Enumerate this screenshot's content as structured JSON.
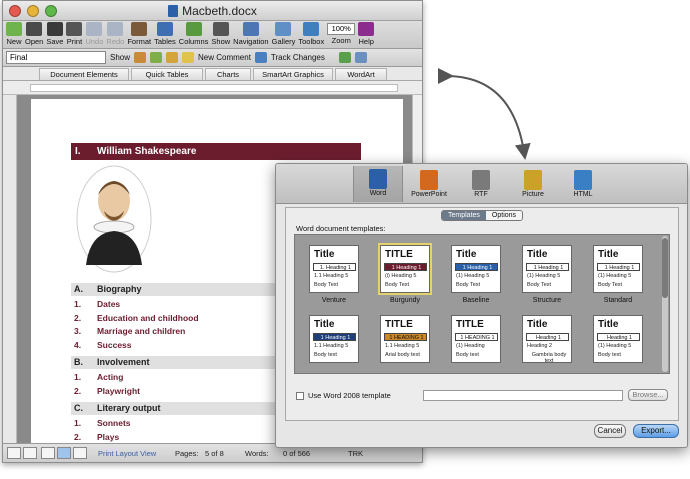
{
  "window": {
    "title": "Macbeth.docx"
  },
  "toolbar": {
    "buttons": [
      {
        "label": "New",
        "icon": "new-document-icon",
        "color": "#6fb34f"
      },
      {
        "label": "Open",
        "icon": "open-folder-icon",
        "color": "#4a4a4a"
      },
      {
        "label": "Save",
        "icon": "save-disk-icon",
        "color": "#3a3a3a"
      },
      {
        "label": "Print",
        "icon": "printer-icon",
        "color": "#555555"
      },
      {
        "label": "Undo",
        "icon": "undo-icon",
        "color": "#aab4c4"
      },
      {
        "label": "Redo",
        "icon": "redo-icon",
        "color": "#aab4c4"
      },
      {
        "label": "Format",
        "icon": "paintbrush-icon",
        "color": "#7a5a3a"
      },
      {
        "label": "Tables",
        "icon": "table-icon",
        "color": "#3f6fb0"
      },
      {
        "label": "Columns",
        "icon": "columns-icon",
        "color": "#5a9a3f"
      },
      {
        "label": "Show",
        "icon": "pilcrow-icon",
        "color": "#555555"
      },
      {
        "label": "Navigation",
        "icon": "navigation-pane-icon",
        "color": "#4d76b5"
      },
      {
        "label": "Gallery",
        "icon": "gallery-icon",
        "color": "#5f8fc7"
      },
      {
        "label": "Toolbox",
        "icon": "toolbox-icon",
        "color": "#3f7fc0"
      },
      {
        "label": "Zoom",
        "icon": "zoom-icon",
        "color": "#ffffff"
      },
      {
        "label": "Help",
        "icon": "help-icon",
        "color": "#8a2d8c"
      }
    ],
    "zoom_value": "100%"
  },
  "toolbar2": {
    "style_value": "Final",
    "show_label": "Show",
    "new_comment_label": "New Comment",
    "track_changes_label": "Track Changes"
  },
  "ribbon": {
    "tabs": [
      "Document Elements",
      "Quick Tables",
      "Charts",
      "SmartArt Graphics",
      "WordArt"
    ]
  },
  "document": {
    "chapter": {
      "number": "I.",
      "title": "William Shakespeare"
    },
    "sections": [
      {
        "letter": "A.",
        "title": "Biography",
        "items": [
          {
            "n": "1.",
            "t": "Dates"
          },
          {
            "n": "2.",
            "t": "Education and childhood"
          },
          {
            "n": "3.",
            "t": "Marriage and children"
          },
          {
            "n": "4.",
            "t": "Success"
          }
        ]
      },
      {
        "letter": "B.",
        "title": "Involvement",
        "items": [
          {
            "n": "1.",
            "t": "Acting"
          },
          {
            "n": "2.",
            "t": "Playwright"
          }
        ]
      },
      {
        "letter": "C.",
        "title": "Literary output",
        "items": [
          {
            "n": "1.",
            "t": "Sonnets"
          },
          {
            "n": "2.",
            "t": "Plays"
          }
        ]
      }
    ],
    "accent_color": "#6b1d2e"
  },
  "statusbar": {
    "view_name": "Print Layout View",
    "pages_label": "Pages:",
    "pages_value": "5 of 8",
    "words_label": "Words:",
    "words_value": "0 of 566",
    "trk_label": "TRK"
  },
  "dialog": {
    "formats": [
      {
        "label": "Word",
        "icon": "word-format-icon",
        "color": "#2b5fa8"
      },
      {
        "label": "PowerPoint",
        "icon": "powerpoint-format-icon",
        "color": "#d2691e"
      },
      {
        "label": "RTF",
        "icon": "rtf-format-icon",
        "color": "#7a7a7a"
      },
      {
        "label": "Picture",
        "icon": "picture-format-icon",
        "color": "#c9a227"
      },
      {
        "label": "HTML",
        "icon": "html-format-icon",
        "color": "#3a7fc4"
      }
    ],
    "tabs": [
      "Templates",
      "Options"
    ],
    "templates_label": "Word document templates:",
    "templates": [
      {
        "name": "Venture",
        "title": "Title",
        "h1": "1. Heading 1",
        "l2": "1.1 Heading 5",
        "l3": "Body Text",
        "h1bg": "#ffffff",
        "h1fg": "#111111"
      },
      {
        "name": "Burgundy",
        "title": "TITLE",
        "h1": "1 Heading 1",
        "l2": "(i) Heading 5",
        "l3": "Body Text",
        "h1bg": "#6b1d2e",
        "h1fg": "#ffffff"
      },
      {
        "name": "Baseline",
        "title": "Title",
        "h1": "1 Heading 1",
        "l2": "(1) Heading 5",
        "l3": "Body Text",
        "h1bg": "#2b5fa8",
        "h1fg": "#ffffff"
      },
      {
        "name": "Structure",
        "title": "Title",
        "h1": "1 Heading 1",
        "l2": "(1) Heading 5",
        "l3": "Body Text",
        "h1bg": "#ffffff",
        "h1fg": "#111111"
      },
      {
        "name": "Standard",
        "title": "Title",
        "h1": "1 Heading 1",
        "l2": "(1) Heading 5",
        "l3": "Body Text",
        "h1bg": "#ffffff",
        "h1fg": "#111111"
      },
      {
        "name": "",
        "title": "Title",
        "h1": "1 Heading 1",
        "l2": "1.1 Heading 5",
        "l3": "Body text",
        "h1bg": "#1e3f7a",
        "h1fg": "#ffffff"
      },
      {
        "name": "",
        "title": "TITLE",
        "h1": "1 HEADING 1",
        "l2": "1.1 Heading 5",
        "l3": "Arial body text",
        "h1bg": "#c9882a",
        "h1fg": "#111111"
      },
      {
        "name": "",
        "title": "TITLE",
        "h1": "1 HEADING 1",
        "l2": "(1) Heading",
        "l3": "Body text",
        "h1bg": "#ffffff",
        "h1fg": "#111111"
      },
      {
        "name": "",
        "title": "Title",
        "h1": "Heading 1",
        "l2": "Heading 2",
        "l3": "Gambria body text",
        "h1bg": "#ffffff",
        "h1fg": "#111111"
      },
      {
        "name": "",
        "title": "Title",
        "h1": "Heading 1",
        "l2": "(1) Heading 5",
        "l3": "Body text",
        "h1bg": "#ffffff",
        "h1fg": "#111111"
      }
    ],
    "checkbox_label": "Use Word 2008 template",
    "browse_label": "Browse...",
    "cancel_label": "Cancel",
    "export_label": "Export..."
  }
}
